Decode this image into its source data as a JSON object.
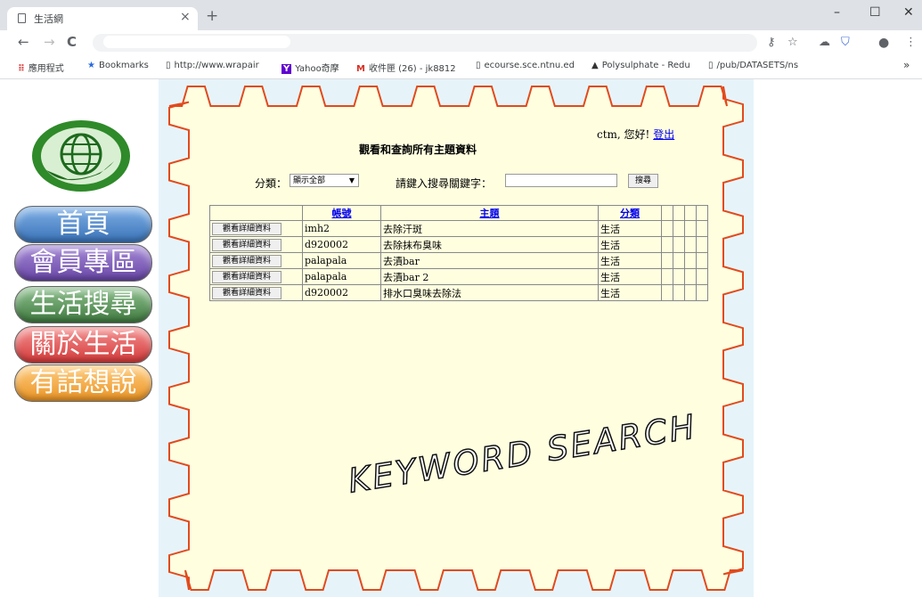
{
  "browser": {
    "tab_title": "生活網",
    "tab_close": "×",
    "new_tab": "+",
    "window_controls": {
      "minimize": "–",
      "maximize": "☐",
      "close": "✕"
    },
    "nav": {
      "back": "←",
      "forward": "→",
      "reload": "C"
    },
    "toolbar_icons": [
      "key-icon",
      "star-icon",
      "cloud-icon",
      "shield-icon",
      "profile-icon",
      "menu-icon"
    ],
    "bookmarks": [
      {
        "label": "應用程式",
        "icon": "apps-icon"
      },
      {
        "label": "Bookmarks",
        "icon": "star-icon"
      },
      {
        "label": "http://www.wrapair",
        "icon": "page-icon"
      },
      {
        "label": "Yahoo奇摩",
        "icon": "yahoo-icon"
      },
      {
        "label": "收件匣 (26) - jk8812",
        "icon": "gmail-icon"
      },
      {
        "label": "ecourse.sce.ntnu.ed",
        "icon": "page-icon"
      },
      {
        "label": "Polysulphate - Redu",
        "icon": "poly-icon"
      },
      {
        "label": "/pub/DATASETS/ns",
        "icon": "page-icon"
      }
    ],
    "bookmarks_more": "»"
  },
  "sidebar": {
    "items": [
      {
        "label": "首頁",
        "color": "#4a86c8"
      },
      {
        "label": "會員專區",
        "color": "#7b5bb4"
      },
      {
        "label": "生活搜尋",
        "color": "#4f8a4f"
      },
      {
        "label": "關於生活",
        "color": "#e04a4a"
      },
      {
        "label": "有話想說",
        "color": "#f0a030"
      }
    ]
  },
  "page": {
    "greeting": "ctm, 您好!",
    "logout": "登出",
    "title": "觀看和查詢所有主題資料",
    "category_label": "分類：",
    "category_value": "顯示全部",
    "keyword_label": "請鍵入搜尋關鍵字：",
    "keyword_value": "",
    "search_button": "搜尋",
    "table": {
      "headers": [
        "帳號",
        "主題",
        "分類"
      ],
      "detail_button": "觀看詳細資料",
      "rows": [
        {
          "account": "imh2",
          "subject": "去除汗斑",
          "category": "生活"
        },
        {
          "account": "d920002",
          "subject": "去除抹布臭味",
          "category": "生活"
        },
        {
          "account": "palapala",
          "subject": "去漬bar",
          "category": "生活"
        },
        {
          "account": "palapala",
          "subject": "去漬bar 2",
          "category": "生活"
        },
        {
          "account": "d920002",
          "subject": "排水口臭味去除法",
          "category": "生活"
        }
      ]
    },
    "banner_text": "KEYWORD SEARCH"
  },
  "colors": {
    "panel_fill": "#ffffe0",
    "gear_stroke": "#e24a1d",
    "stage_bg": "#e6f4fa"
  }
}
